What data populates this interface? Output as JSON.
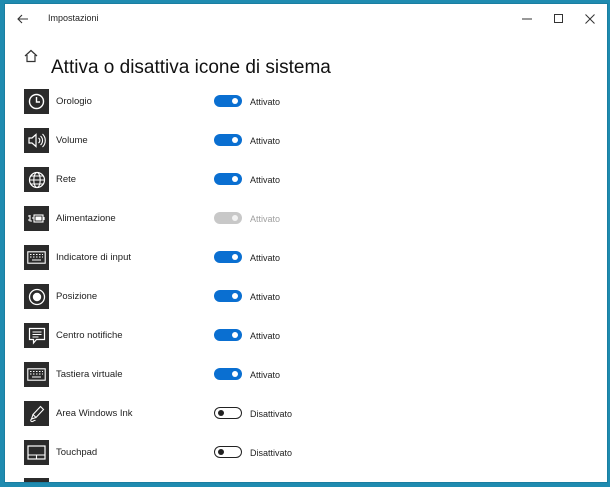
{
  "window": {
    "app_title": "Impostazioni"
  },
  "page": {
    "title": "Attiva o disattiva icone di sistema"
  },
  "items": [
    {
      "label": "Orologio",
      "state": "Attivato",
      "toggle": "on",
      "icon": "clock-icon"
    },
    {
      "label": "Volume",
      "state": "Attivato",
      "toggle": "on",
      "icon": "speaker-icon"
    },
    {
      "label": "Rete",
      "state": "Attivato",
      "toggle": "on",
      "icon": "globe-icon"
    },
    {
      "label": "Alimentazione",
      "state": "Attivato",
      "toggle": "disabled",
      "icon": "battery-plug-icon"
    },
    {
      "label": "Indicatore di input",
      "state": "Attivato",
      "toggle": "on",
      "icon": "keyboard-icon"
    },
    {
      "label": "Posizione",
      "state": "Attivato",
      "toggle": "on",
      "icon": "location-icon"
    },
    {
      "label": "Centro notifiche",
      "state": "Attivato",
      "toggle": "on",
      "icon": "notification-icon"
    },
    {
      "label": "Tastiera virtuale",
      "state": "Attivato",
      "toggle": "on",
      "icon": "keyboard-icon"
    },
    {
      "label": "Area Windows Ink",
      "state": "Disattivato",
      "toggle": "off",
      "icon": "pen-icon"
    },
    {
      "label": "Touchpad",
      "state": "Disattivato",
      "toggle": "off",
      "icon": "touchpad-icon"
    }
  ],
  "colors": {
    "accent": "#0a6fd1",
    "desktop": "#1f8bb0",
    "icon_bg": "#2b2b2b"
  }
}
